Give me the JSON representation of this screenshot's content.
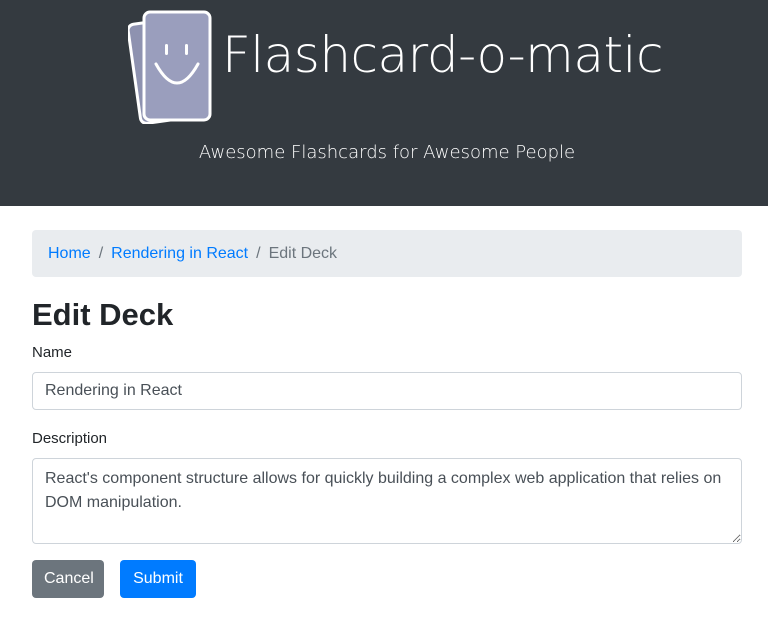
{
  "header": {
    "title": "Flashcard-o-matic",
    "tagline": "Awesome Flashcards for Awesome People",
    "logo_icon": "smiley-flashcard-icon"
  },
  "breadcrumb": {
    "home": "Home",
    "deck": "Rendering in React",
    "separator": "/",
    "current": "Edit Deck"
  },
  "page": {
    "title": "Edit Deck"
  },
  "form": {
    "name_label": "Name",
    "name_value": "Rendering in React",
    "description_label": "Description",
    "description_value": "React's component structure allows for quickly building a complex web application that relies on DOM manipulation.",
    "cancel_label": "Cancel",
    "submit_label": "Submit"
  },
  "colors": {
    "header_bg": "#343a40",
    "primary": "#007bff",
    "secondary": "#6c757d",
    "breadcrumb_bg": "#e9ecef"
  }
}
